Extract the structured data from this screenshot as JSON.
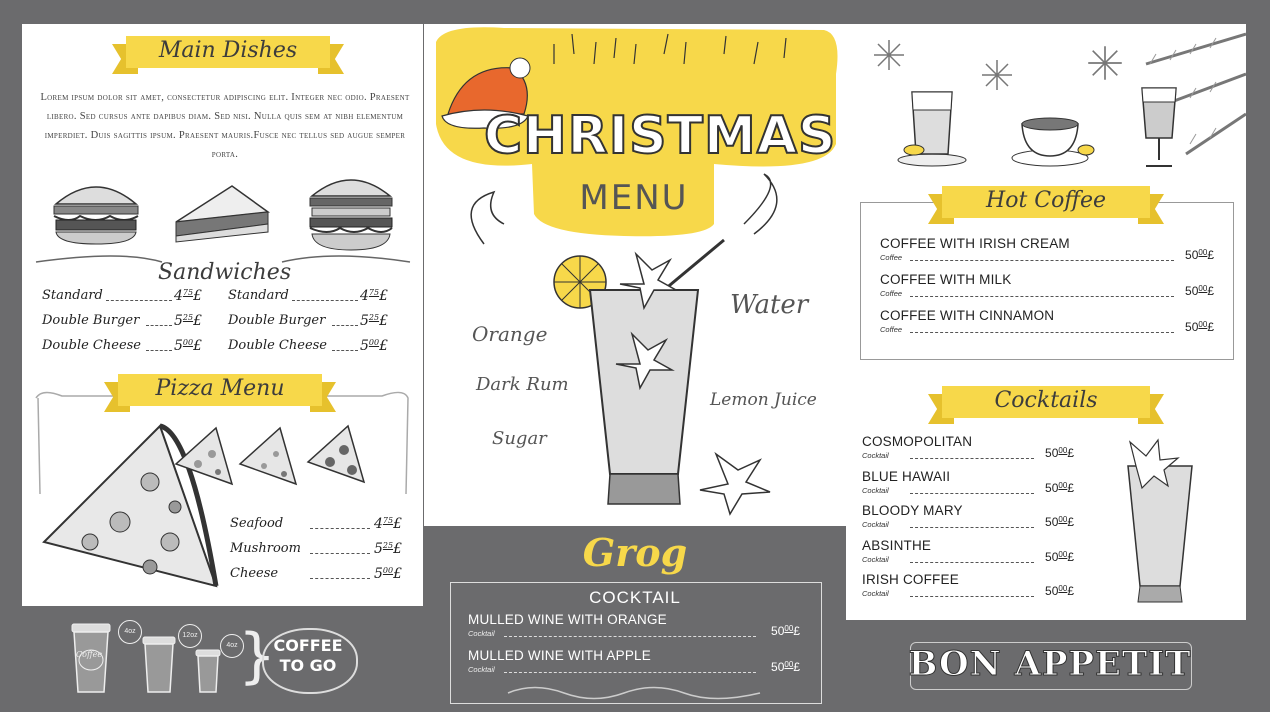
{
  "colors": {
    "accent": "#f7d84a",
    "dark": "#6b6b6d",
    "ink": "#3c3c3c"
  },
  "main": {
    "title": "Main Dishes",
    "lorem": "Lorem ipsum dolor sit amet, consectetur adipiscing elit. Integer nec odio. Praesent libero. Sed cursus ante dapibus diam. Sed nisi. Nulla quis sem at nibh elementum imperdiet. Duis sagittis ipsum. Praesent mauris.Fusce nec tellus sed augue semper porta."
  },
  "sandwiches": {
    "title": "Sandwiches",
    "items": [
      {
        "name": "Standard",
        "int": "4",
        "sup": "75",
        "cur": "£"
      },
      {
        "name": "Standard",
        "int": "4",
        "sup": "75",
        "cur": "£"
      },
      {
        "name": "Double Burger",
        "int": "5",
        "sup": "25",
        "cur": "£"
      },
      {
        "name": "Double Burger",
        "int": "5",
        "sup": "25",
        "cur": "£"
      },
      {
        "name": "Double Cheese",
        "int": "5",
        "sup": "00",
        "cur": "£"
      },
      {
        "name": "Double Cheese",
        "int": "5",
        "sup": "00",
        "cur": "£"
      }
    ]
  },
  "pizza": {
    "title": "Pizza Menu",
    "items": [
      {
        "name": "Seafood",
        "int": "4",
        "sup": "75",
        "cur": "£"
      },
      {
        "name": "Mushroom",
        "int": "5",
        "sup": "25",
        "cur": "£"
      },
      {
        "name": "Cheese",
        "int": "5",
        "sup": "00",
        "cur": "£"
      }
    ]
  },
  "center": {
    "title_main": "CHRISTMAS",
    "title_sub": "MENU",
    "labels": {
      "orange": "Orange",
      "dark_rum": "Dark Rum",
      "sugar": "Sugar",
      "water": "Water",
      "lemon": "Lemon Juice"
    }
  },
  "grog": {
    "title": "Grog",
    "subtitle": "COCKTAIL",
    "items": [
      {
        "name": "MULLED WINE WITH ORANGE",
        "sub": "Cocktail",
        "int": "50",
        "sup": "00",
        "cur": "£"
      },
      {
        "name": "MULLED WINE WITH APPLE",
        "sub": "Cocktail",
        "int": "50",
        "sup": "00",
        "cur": "£"
      }
    ]
  },
  "hot_coffee": {
    "title": "Hot Coffee",
    "items": [
      {
        "name": "COFFEE WITH IRISH CREAM",
        "sub": "Coffee",
        "int": "50",
        "sup": "00",
        "cur": "£"
      },
      {
        "name": "COFFEE WITH MILK",
        "sub": "Coffee",
        "int": "50",
        "sup": "00",
        "cur": "£"
      },
      {
        "name": "COFFEE WITH CINNAMON",
        "sub": "Coffee",
        "int": "50",
        "sup": "00",
        "cur": "£"
      }
    ]
  },
  "cocktails": {
    "title": "Cocktails",
    "items": [
      {
        "name": "COSMOPOLITAN",
        "sub": "Cocktail",
        "int": "50",
        "sup": "00",
        "cur": "£"
      },
      {
        "name": "BLUE HAWAII",
        "sub": "Cocktail",
        "int": "50",
        "sup": "00",
        "cur": "£"
      },
      {
        "name": "BLOODY MARY",
        "sub": "Cocktail",
        "int": "50",
        "sup": "00",
        "cur": "£"
      },
      {
        "name": "ABSINTHE",
        "sub": "Cocktail",
        "int": "50",
        "sup": "00",
        "cur": "£"
      },
      {
        "name": "IRISH COFFEE",
        "sub": "Cocktail",
        "int": "50",
        "sup": "00",
        "cur": "£"
      }
    ]
  },
  "coffee_to_go": {
    "line1": "COFFEE",
    "line2": "TO GO",
    "cup_label": "Coffee",
    "sizes": [
      "4oz",
      "12oz",
      "4oz"
    ]
  },
  "footer": {
    "bon_appetit": "BON APPETIT"
  }
}
